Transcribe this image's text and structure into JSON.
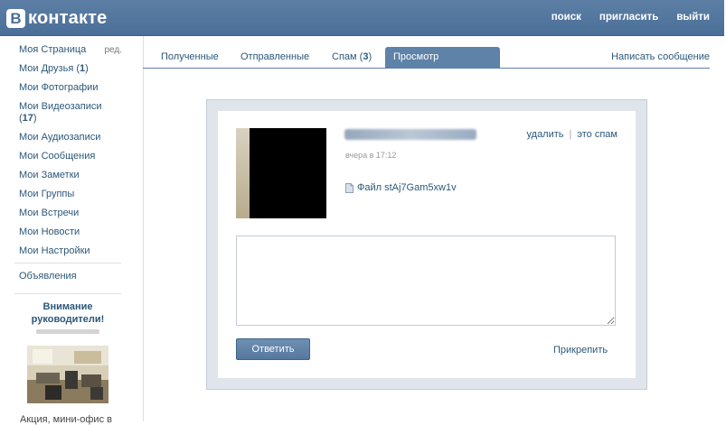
{
  "header": {
    "logo_letter": "В",
    "logo_text": "контакте",
    "links": [
      "поиск",
      "пригласить",
      "выйти"
    ]
  },
  "sidebar": {
    "items": [
      {
        "label": "Моя Страница",
        "count": ""
      },
      {
        "label": "Мои Друзья",
        "count": "1"
      },
      {
        "label": "Мои Фотографии",
        "count": ""
      },
      {
        "label": "Мои Видеозаписи",
        "count": "17"
      },
      {
        "label": "Мои Аудиозаписи",
        "count": ""
      },
      {
        "label": "Мои Сообщения",
        "count": ""
      },
      {
        "label": "Мои Заметки",
        "count": ""
      },
      {
        "label": "Мои Группы",
        "count": ""
      },
      {
        "label": "Мои Встречи",
        "count": ""
      },
      {
        "label": "Мои Новости",
        "count": ""
      },
      {
        "label": "Мои Настройки",
        "count": ""
      }
    ],
    "edit_label": "ред.",
    "ads_link": "Объявления",
    "ad_title": "Внимание руководители!",
    "ad_text": "Акция, мини-офис в"
  },
  "tabs": {
    "items": [
      {
        "label": "Полученные"
      },
      {
        "label": "Отправленные"
      },
      {
        "label": "Спам",
        "count": "3"
      },
      {
        "label": "Просмотр сообщения",
        "active": true
      }
    ],
    "write_label": "Написать сообщение"
  },
  "message": {
    "date": "вчера в 17:12",
    "delete_label": "удалить",
    "spam_label": "это спам",
    "attachment": "Файл stAj7Gam5xw1v",
    "reply_button": "Ответить",
    "attach_link": "Прикрепить"
  },
  "colors": {
    "header": "#4a6f98",
    "link": "#2b587a",
    "active_tab": "#5e82a8",
    "panel_bg": "#dfe5eb"
  }
}
